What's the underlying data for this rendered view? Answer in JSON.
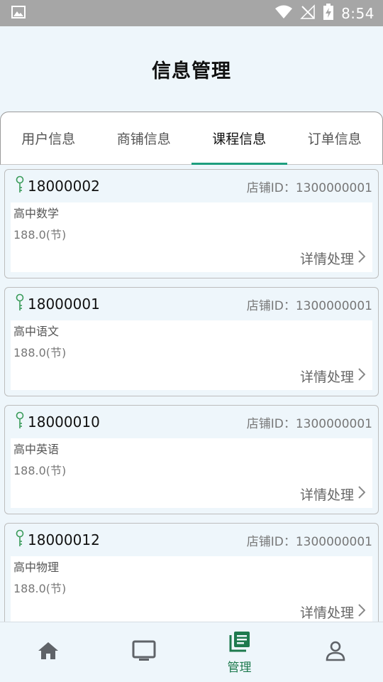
{
  "status_bar": {
    "time": "8:54"
  },
  "header": {
    "title": "信息管理"
  },
  "tabs": [
    {
      "label": "用户信息",
      "active": false
    },
    {
      "label": "商铺信息",
      "active": false
    },
    {
      "label": "课程信息",
      "active": true
    },
    {
      "label": "订单信息",
      "active": false
    }
  ],
  "cards": [
    {
      "id": "18000002",
      "shop": "店铺ID：1300000001",
      "course": "高中数学",
      "price": "188.0(节)",
      "action": "详情处理"
    },
    {
      "id": "18000001",
      "shop": "店铺ID：1300000001",
      "course": "高中语文",
      "price": "188.0(节)",
      "action": "详情处理"
    },
    {
      "id": "18000010",
      "shop": "店铺ID：1300000001",
      "course": "高中英语",
      "price": "188.0(节)",
      "action": "详情处理"
    },
    {
      "id": "18000012",
      "shop": "店铺ID：1300000001",
      "course": "高中物理",
      "price": "188.0(节)",
      "action": "详情处理"
    }
  ],
  "bottom_nav": {
    "items": [
      {
        "icon": "home-icon",
        "label": ""
      },
      {
        "icon": "monitor-icon",
        "label": ""
      },
      {
        "icon": "manage-icon",
        "label": "管理"
      },
      {
        "icon": "person-icon",
        "label": ""
      }
    ]
  },
  "colors": {
    "accent": "#1e9e7e",
    "nav_active": "#1e7a4e",
    "icon_green": "#3a9b5a",
    "status_bar": "#a6a6a6"
  }
}
